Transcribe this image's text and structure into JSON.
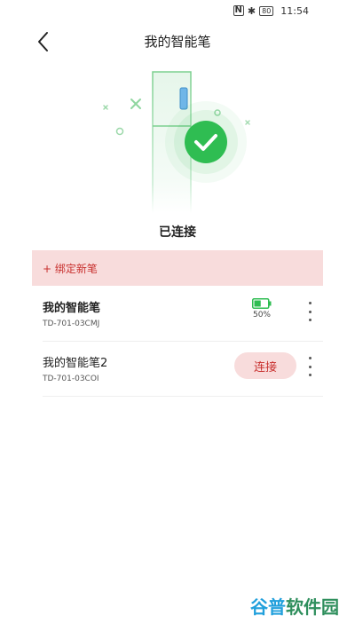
{
  "status_bar": {
    "time": "11:54",
    "battery": "80",
    "nfc": "N",
    "bluetooth": "✱"
  },
  "header": {
    "title": "我的智能笔",
    "back_icon": "chevron-left-icon"
  },
  "hero": {
    "status_text": "已连接",
    "check_icon": "check-circle-icon",
    "accent_color": "#2fbd52"
  },
  "bind": {
    "label": "+ 绑定新笔",
    "bg_color": "#f8dcdc",
    "text_color": "#c8302e"
  },
  "pens": [
    {
      "name": "我的智能笔",
      "id": "TD-701-03CMJ",
      "battery_percent": "50%",
      "battery_level": 0.5,
      "connected": true
    },
    {
      "name": "我的智能笔2",
      "id": "TD-701-03COI",
      "action_label": "连接",
      "connected": false
    }
  ],
  "watermark": {
    "part1": "谷普",
    "part2": "软件园"
  }
}
